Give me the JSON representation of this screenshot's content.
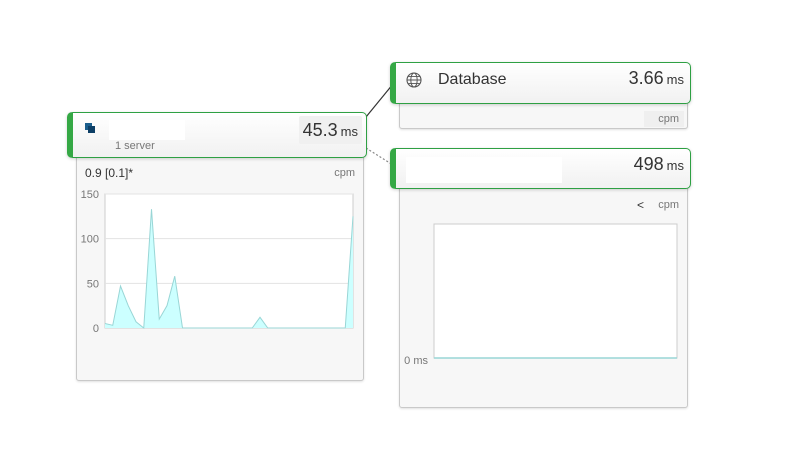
{
  "connector_colors": {
    "solid": "#333333",
    "dotted": "#888888"
  },
  "app_node": {
    "icon": "server-stack-icon",
    "subtitle": "1 server",
    "time_value": "45.3",
    "time_unit": "ms",
    "rate_text": "0.9 [0.1]*",
    "rate_unit": "cpm"
  },
  "database_node": {
    "icon": "globe-icon",
    "title": "Database",
    "time_value": "3.66",
    "time_unit": "ms",
    "rate_unit": "cpm"
  },
  "external_node": {
    "time_value": "498",
    "time_unit": "ms",
    "rate_prefix": "<",
    "rate_unit": "cpm",
    "y_label": "0 ms"
  },
  "chart_data": [
    {
      "type": "area",
      "y_ticks": [
        "150",
        "100",
        "50",
        "0"
      ],
      "ylim": [
        0,
        150
      ],
      "x": [
        0,
        1,
        2,
        3,
        4,
        5,
        6,
        7,
        8,
        9,
        10,
        11,
        12,
        13,
        14,
        15,
        16,
        17,
        18,
        19,
        20,
        21,
        22,
        23,
        24,
        25,
        26,
        27,
        28,
        29,
        30,
        31,
        32
      ],
      "values": [
        5,
        3,
        47,
        25,
        7,
        0,
        133,
        10,
        25,
        58,
        0,
        0,
        0,
        0,
        0,
        0,
        0,
        0,
        0,
        0,
        12,
        0,
        0,
        0,
        0,
        0,
        0,
        0,
        0,
        0,
        0,
        0,
        125
      ],
      "color": "#ccffff",
      "line_color": "#99d6d6",
      "grid": true
    },
    {
      "type": "line",
      "values": [
        0,
        0
      ],
      "line_color": "#99d6d6",
      "grid": false
    }
  ]
}
